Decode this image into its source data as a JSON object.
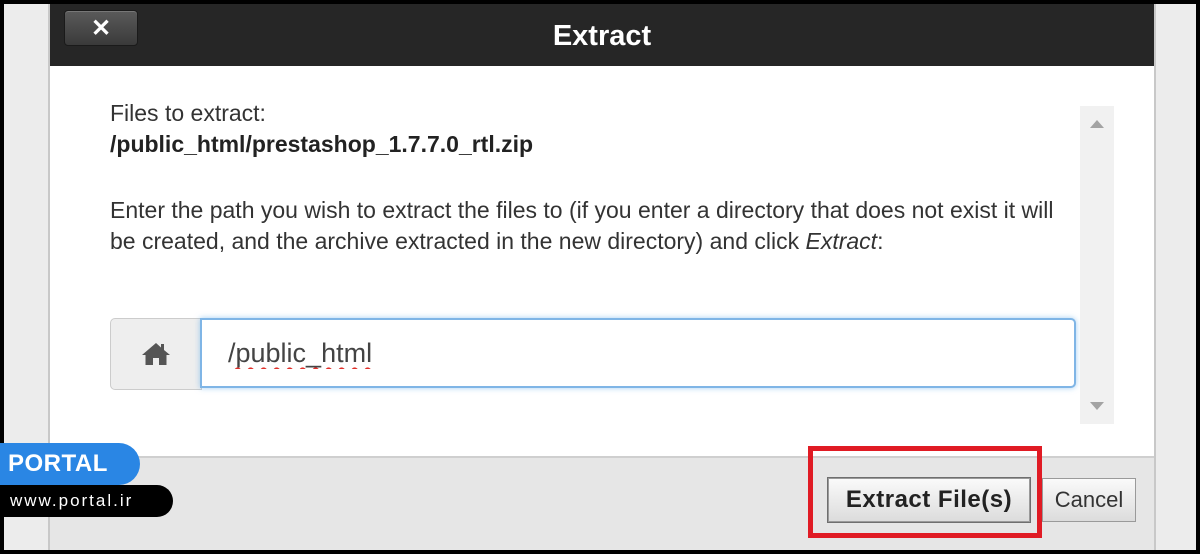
{
  "dialog": {
    "title": "Extract",
    "close_label": "✕"
  },
  "content": {
    "files_label": "Files to extract:",
    "files_path": "/public_html/prestashop_1.7.7.0_rtl.zip",
    "instructions_prefix": "Enter the path you wish to extract the files to (if you enter a directory that does not exist it will be created, and the archive extracted in the new directory) and click ",
    "instructions_emphasis": "Extract",
    "instructions_suffix": ":"
  },
  "path_input": {
    "value": "/public_html",
    "addon_icon": "home-icon"
  },
  "footer": {
    "extract_label": "Extract File(s)",
    "cancel_label": "Cancel"
  },
  "watermark": {
    "brand": "PORTAL",
    "url": "www.portal.ir"
  },
  "colors": {
    "titlebar": "#262626",
    "highlight": "#e01b24",
    "badge": "#2a86e4",
    "input_focus": "#7fb5e6"
  }
}
